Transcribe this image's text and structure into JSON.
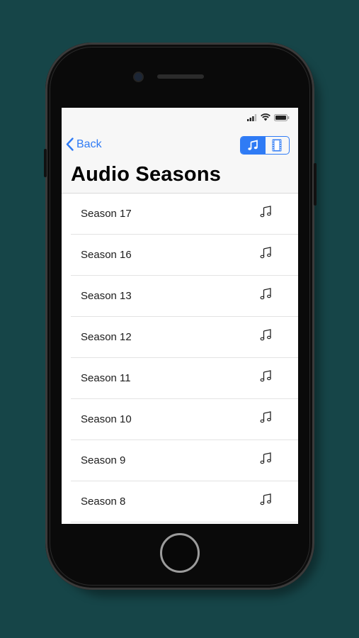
{
  "colors": {
    "background": "#164548",
    "accent": "#2f7bf5"
  },
  "navbar": {
    "back_label": "Back",
    "title": "Audio Seasons",
    "segments": [
      {
        "icon": "music-note-icon",
        "selected": true
      },
      {
        "icon": "film-strip-icon",
        "selected": false
      }
    ]
  },
  "status_bar": {
    "icons": [
      "signal-bars-icon",
      "wifi-icon",
      "battery-icon"
    ]
  },
  "seasons": [
    {
      "label": "Season 17",
      "icon": "music-note-icon"
    },
    {
      "label": "Season 16",
      "icon": "music-note-icon"
    },
    {
      "label": "Season 13",
      "icon": "music-note-icon"
    },
    {
      "label": "Season 12",
      "icon": "music-note-icon"
    },
    {
      "label": "Season 11",
      "icon": "music-note-icon"
    },
    {
      "label": "Season 10",
      "icon": "music-note-icon"
    },
    {
      "label": "Season 9",
      "icon": "music-note-icon"
    },
    {
      "label": "Season 8",
      "icon": "music-note-icon"
    }
  ]
}
